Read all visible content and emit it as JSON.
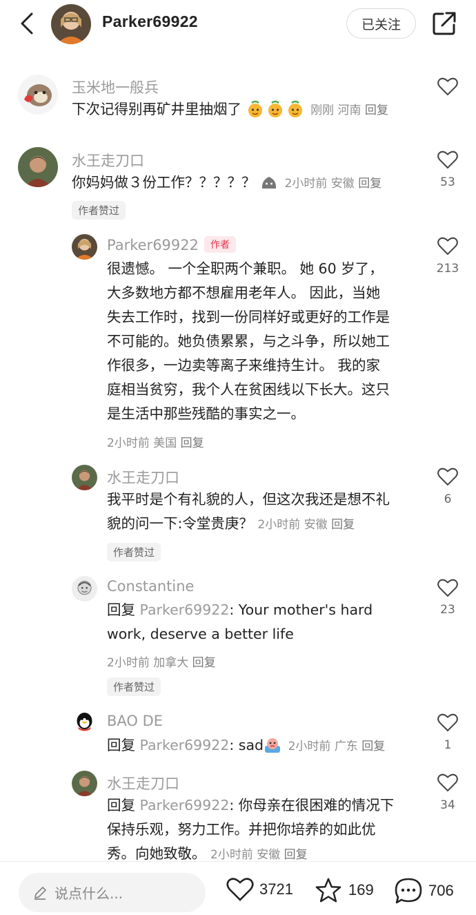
{
  "header": {
    "username": "Parker69922",
    "follow_label": "已关注"
  },
  "comments": [
    {
      "name": "玉米地一般兵",
      "text": "下次记得别再矿井里抽烟了",
      "emoji": [
        "angel-emoji",
        "angel-emoji",
        "angel-emoji"
      ],
      "time": "刚刚",
      "location": "河南",
      "reply": "回复",
      "likes": ""
    },
    {
      "name": "水王走刀口",
      "text": "你妈妈做３份工作？？？？？",
      "time": "2小时前",
      "location": "安徽",
      "reply": "回复",
      "likes": "53",
      "badge": "作者赞过"
    },
    {
      "name": "Parker69922",
      "author_tag": "作者",
      "lines": [
        "很遗憾。 一个全职两个兼职。 她 60 岁了，",
        "大多数地方都不想雇用老年人。 因此，当她",
        "失去工作时，找到一份同样好或更好的工作是",
        "不可能的。她负债累累，与之斗争，所以她工",
        "作很多，一边卖等离子来维持生计。 我的家",
        "庭相当贫穷，我个人在贫困线以下长大。这只",
        "是生活中那些残酷的事实之一。"
      ],
      "time": "2小时前",
      "location": "美国",
      "reply": "回复",
      "likes": "213"
    },
    {
      "name": "水王走刀口",
      "lines": [
        "我平时是个有礼貌的人，但这次我还是想不礼",
        "貌的问一下:令堂贵庚？"
      ],
      "time": "2小时前",
      "location": "安徽",
      "reply": "回复",
      "likes": "6",
      "badge": "作者赞过"
    },
    {
      "name": "Constantine",
      "reply_prefix": "回复",
      "reply_to": "Parker69922",
      "lines": [
        ": Your mother's hard",
        "work, deserve a better life"
      ],
      "time": "2小时前",
      "location": "加拿大",
      "reply": "回复",
      "likes": "23",
      "badge": "作者赞过"
    },
    {
      "name": "BAO DE",
      "reply_prefix": "回复",
      "reply_to": "Parker69922",
      "text": ": sad",
      "time": "2小时前",
      "location": "广东",
      "reply": "回复",
      "likes": "1"
    },
    {
      "name": "水王走刀口",
      "reply_prefix": "回复",
      "reply_to": "Parker69922",
      "lines": [
        ": 你母亲在很困难的情况下",
        "保持乐观，努力工作。并把你培养的如此优",
        "秀。向她致敬。"
      ],
      "time": "2小时前",
      "location": "安徽",
      "reply": "回复",
      "likes": "34"
    }
  ],
  "bottom_bar": {
    "input_placeholder": "说点什么...",
    "likes": "3721",
    "favorites": "169",
    "comments": "706"
  }
}
